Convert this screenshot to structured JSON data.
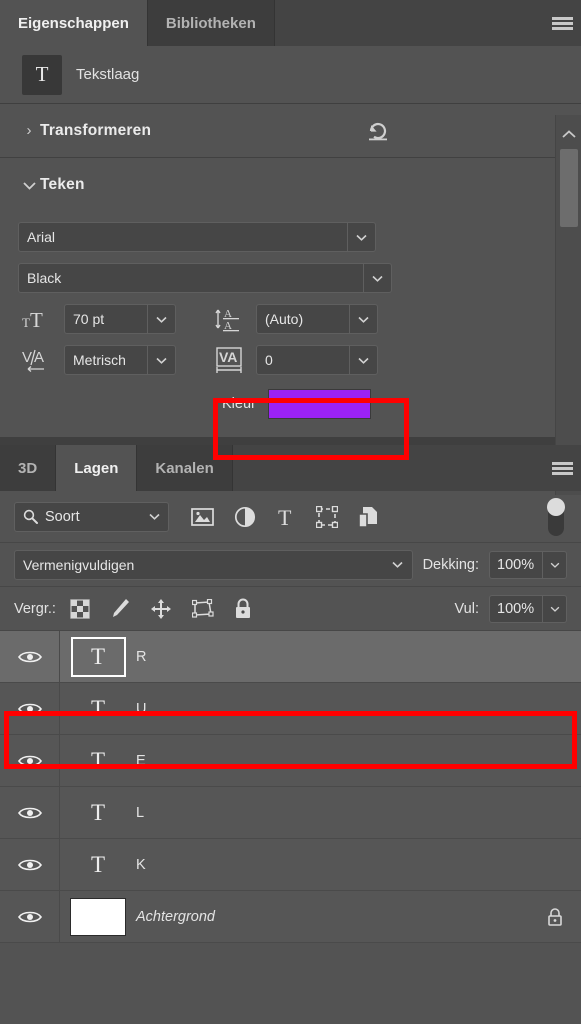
{
  "properties_panel": {
    "tabs": [
      {
        "label": "Eigenschappen",
        "active": true
      },
      {
        "label": "Bibliotheken",
        "active": false
      }
    ],
    "menu_icon": "hamburger-menu-icon",
    "layer_type": {
      "thumb_glyph": "T",
      "label": "Tekstlaag"
    },
    "sections": [
      {
        "title": "Transformeren",
        "twisty": "›",
        "collapsed": true,
        "reset_icon": "reset-arrow-icon"
      },
      {
        "title": "Teken",
        "twisty": "⌄",
        "collapsed": false
      }
    ],
    "character": {
      "font_family": "Arial",
      "font_style": "Black",
      "size_icon": "font-size-icon",
      "size_value": "70 pt",
      "leading_icon": "leading-icon",
      "leading_value": "(Auto)",
      "kerning_icon": "kerning-icon",
      "kerning_value": "Metrisch",
      "tracking_icon": "tracking-icon",
      "tracking_value": "0",
      "color_label": "Kleur",
      "color_value": "#9b22f5"
    },
    "scrollbar": {
      "up_icon": "chevron-up-icon",
      "down_icon": "chevron-down-icon"
    }
  },
  "layers_panel": {
    "tabs": [
      {
        "label": "3D",
        "active": false
      },
      {
        "label": "Lagen",
        "active": true
      },
      {
        "label": "Kanalen",
        "active": false
      }
    ],
    "menu_icon": "hamburger-menu-icon",
    "filter": {
      "search_icon": "search-icon",
      "kind_label": "Soort",
      "icons": [
        "pixel-layer-filter-icon",
        "adjustment-layer-filter-icon",
        "type-layer-filter-icon",
        "shape-layer-filter-icon",
        "smart-object-filter-icon"
      ],
      "toggle_icon": "filter-toggle-switch"
    },
    "blend": {
      "mode": "Vermenigvuldigen",
      "opacity_label": "Dekking:",
      "opacity_value": "100%"
    },
    "lock": {
      "label": "Vergr.:",
      "icons": [
        "lock-transparent-pixels-icon",
        "lock-image-pixels-icon",
        "lock-position-icon",
        "lock-artboard-nesting-icon",
        "lock-all-icon"
      ],
      "fill_label": "Vul:",
      "fill_value": "100%"
    },
    "layers": [
      {
        "name": "R",
        "type": "text",
        "visible": true,
        "selected": true,
        "locked": false
      },
      {
        "name": "U",
        "type": "text",
        "visible": true,
        "selected": false,
        "locked": false
      },
      {
        "name": "E",
        "type": "text",
        "visible": true,
        "selected": false,
        "locked": false
      },
      {
        "name": "L",
        "type": "text",
        "visible": true,
        "selected": false,
        "locked": false
      },
      {
        "name": "K",
        "type": "text",
        "visible": true,
        "selected": false,
        "locked": false
      },
      {
        "name": "Achtergrond",
        "type": "background",
        "visible": true,
        "selected": false,
        "locked": true
      }
    ]
  },
  "annotations": {
    "highlight_color": "#ff0000",
    "boxes": [
      {
        "name": "kleur-highlight"
      },
      {
        "name": "selected-layer-highlight"
      }
    ]
  }
}
